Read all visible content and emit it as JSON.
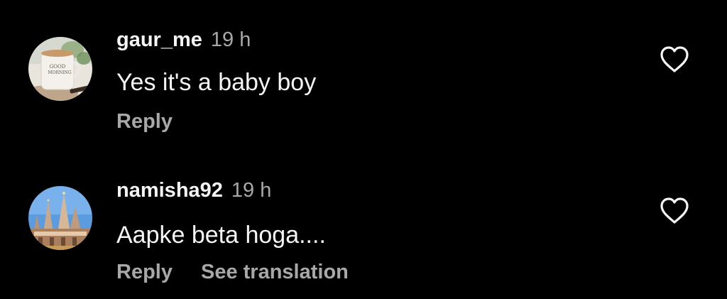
{
  "colors": {
    "background": "#000000",
    "primary_text": "#f5f5f5",
    "secondary_text": "#a8a8a8"
  },
  "comments": [
    {
      "username": "gaur_me",
      "time": "19 h",
      "text": "Yes it's a baby boy",
      "reply_label": "Reply",
      "avatar_caption": "GOOD MORNING",
      "avatar_icon": "coffee-cup-avatar",
      "like_icon": "heart-outline-icon"
    },
    {
      "username": "namisha92",
      "time": "19 h",
      "text": "Aapke beta hoga....",
      "reply_label": "Reply",
      "translate_label": "See translation",
      "avatar_icon": "temple-avatar",
      "like_icon": "heart-outline-icon"
    }
  ]
}
